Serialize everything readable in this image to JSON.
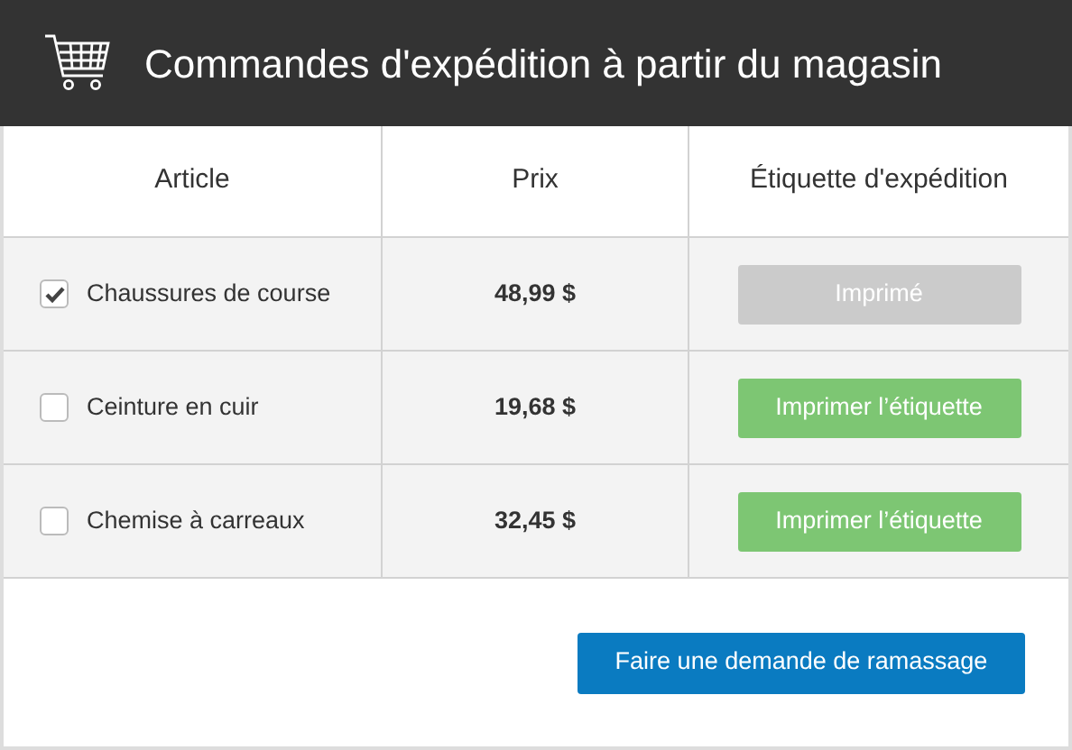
{
  "header": {
    "title": "Commandes d'expédition à partir du magasin"
  },
  "table": {
    "columns": [
      "Article",
      "Prix",
      "Étiquette d'expédition"
    ],
    "rows": [
      {
        "checked": true,
        "article": "Chaussures de course",
        "price": "48,99 $",
        "label_button": "Imprimé",
        "printed": true
      },
      {
        "checked": false,
        "article": "Ceinture en cuir",
        "price": "19,68 $",
        "label_button": "Imprimer l’étiquette",
        "printed": false
      },
      {
        "checked": false,
        "article": "Chemise à carreaux",
        "price": "32,45 $",
        "label_button": "Imprimer l’étiquette",
        "printed": false
      }
    ]
  },
  "footer": {
    "button": "Faire une demande de ramassage"
  }
}
